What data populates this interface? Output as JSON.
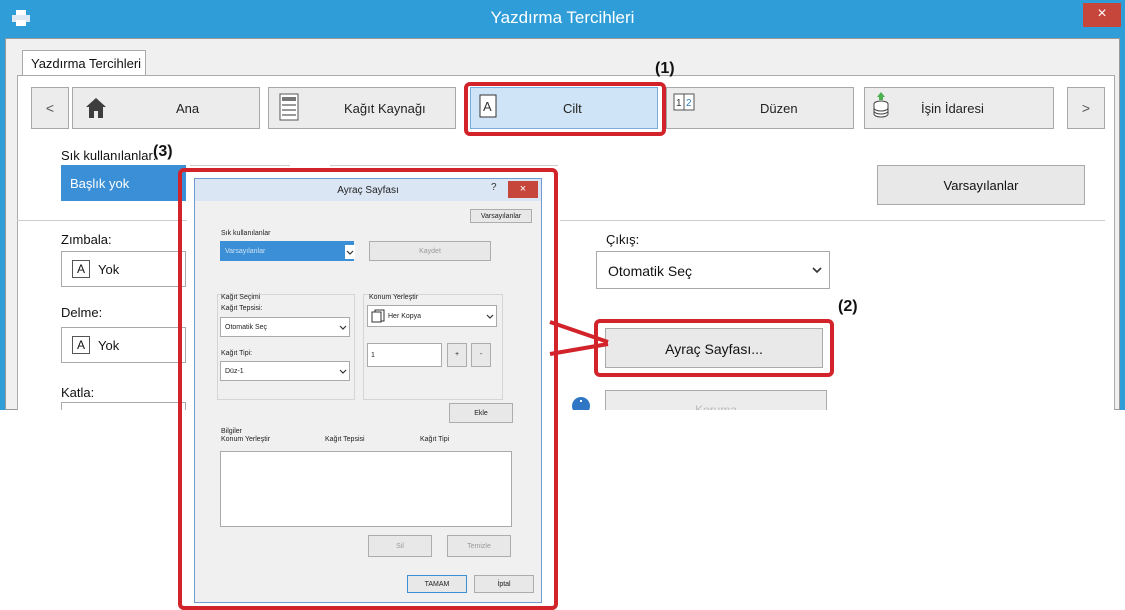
{
  "window": {
    "title": "Yazdırma Tercihleri",
    "close_glyph": "×",
    "tab_label": "Yazdırma Tercihleri"
  },
  "nav": {
    "prev": "<",
    "next": ">",
    "buttons": [
      {
        "label": "Ana",
        "icon": "home-icon"
      },
      {
        "label": "Kağıt Kaynağı",
        "icon": "paper-tray-icon"
      },
      {
        "label": "Cilt",
        "icon": "binding-icon"
      },
      {
        "label": "Düzen",
        "icon": "layout-icon"
      },
      {
        "label": "İşin İdaresi",
        "icon": "job-handling-icon"
      }
    ]
  },
  "callouts": {
    "c1": "(1)",
    "c2": "(2)",
    "c3": "(3)"
  },
  "left_panel": {
    "favorites_label": "Sık kullanılanlar:",
    "favorites_value": "Başlık yok",
    "defaults_button": "Varsayılanlar",
    "staple_label": "Zımbala:",
    "staple_value": "Yok",
    "punch_label": "Delme:",
    "punch_value": "Yok",
    "fold_label": "Katla:",
    "field_glyph": "A"
  },
  "right_panel": {
    "output_label": "Çıkış:",
    "output_value": "Otomatik Seç",
    "divider_button": "Ayraç Sayfası...",
    "hidden_button": "Koruma"
  },
  "dialog": {
    "title": "Ayraç Sayfası",
    "help": "?",
    "close": "×",
    "defaults_button": "Varsayılanlar",
    "favorites_label": "Sık kullanılanlar",
    "favorites_value": "Varsayılanlar",
    "save_button": "Kaydet",
    "paper_selection_label": "Kağıt Seçimi",
    "paper_tray_label": "Kağıt Tepsisi:",
    "paper_tray_value": "Otomatik Seç",
    "paper_type_label": "Kağıt Tipi:",
    "paper_type_value": "Düz-1",
    "position_label": "Konum Yerleştir",
    "position_value": "Her Kopya",
    "count_value": "1",
    "plus": "+",
    "minus": "-",
    "add_button": "Ekle",
    "info_label": "Bilgiler",
    "columns": [
      "Konum Yerleştir",
      "Kağıt Tepsisi",
      "Kağıt Tipi"
    ],
    "delete_button": "Sil",
    "reset_button": "Temizle",
    "ok_button": "TAMAM",
    "cancel_button": "İptal"
  }
}
